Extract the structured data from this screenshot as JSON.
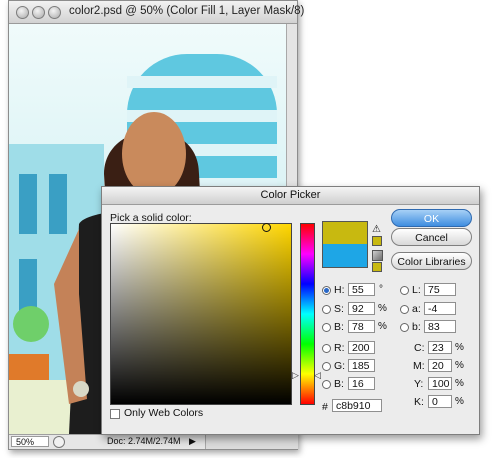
{
  "document_window": {
    "title": "color2.psd @ 50% (Color Fill 1, Layer Mask/8)",
    "zoom": "50%",
    "doc_size": "Doc: 2.74M/2.74M"
  },
  "color_picker": {
    "title": "Color Picker",
    "prompt": "Pick a solid color:",
    "buttons": {
      "ok": "OK",
      "cancel": "Cancel",
      "libraries": "Color Libraries"
    },
    "new_color": "#c8b910",
    "current_color": "#1ea6e6",
    "hsb": {
      "h_label": "H:",
      "h": "55",
      "h_unit": "°",
      "s_label": "S:",
      "s": "92",
      "s_unit": "%",
      "b_label": "B:",
      "b": "78",
      "b_unit": "%"
    },
    "rgb": {
      "r_label": "R:",
      "r": "200",
      "g_label": "G:",
      "g": "185",
      "b_label": "B:",
      "b": "16"
    },
    "lab": {
      "l_label": "L:",
      "l": "75",
      "a_label": "a:",
      "a": "-4",
      "b_label": "b:",
      "b": "83"
    },
    "cmyk": {
      "c_label": "C:",
      "c": "23",
      "c_unit": "%",
      "m_label": "M:",
      "m": "20",
      "m_unit": "%",
      "y_label": "Y:",
      "y": "100",
      "y_unit": "%",
      "k_label": "K:",
      "k": "0",
      "k_unit": "%"
    },
    "hex_label": "#",
    "hex": "c8b910",
    "only_web_colors": "Only Web Colors",
    "selected_mode": "H"
  },
  "icons": [
    "close-icon",
    "minimize-icon",
    "zoom-icon",
    "gamut-warning-icon",
    "web-cube-icon",
    "doc-info-icon",
    "status-arrow-icon"
  ]
}
